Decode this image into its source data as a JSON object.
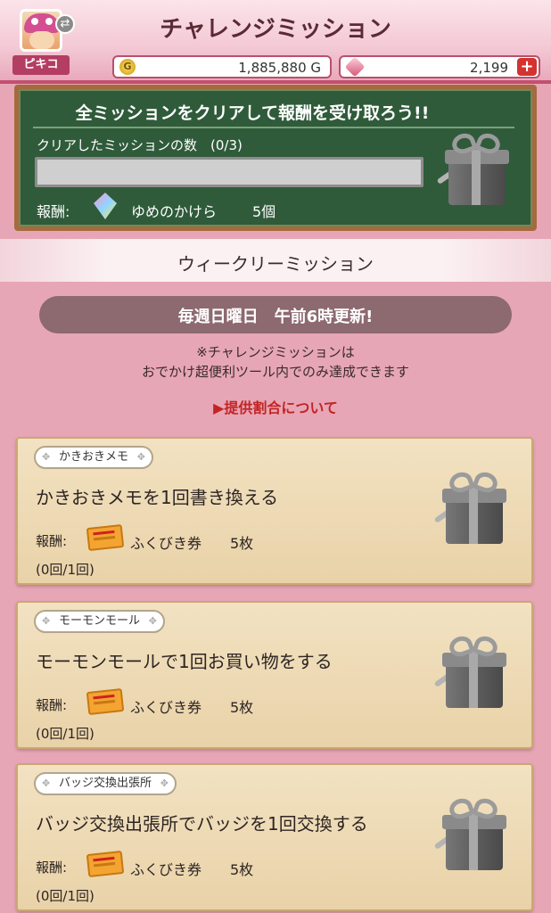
{
  "header": {
    "title": "チャレンジミッション",
    "player_name": "ピキコ",
    "swap_icon": "swap-icon",
    "gold": "1,885,880 G",
    "gold_icon": "G",
    "gems": "2,199",
    "add_symbol": "+"
  },
  "challenge": {
    "headline": "全ミッションをクリアして報酬を受け取ろう!!",
    "count_label": "クリアしたミッションの数　(0/3)",
    "progress_fraction": 0,
    "reward_label": "報酬:",
    "reward_name": "ゆめのかけら",
    "reward_qty": "5個"
  },
  "section": {
    "title": "ウィークリーミッション",
    "schedule": "毎週日曜日　午前6時更新!",
    "note_line1": "※チャレンジミッションは",
    "note_line2": "おでかけ超便利ツール内でのみ達成できます",
    "rate_link": "▶提供割合について"
  },
  "missions": [
    {
      "tag": "かきおきメモ",
      "title": "かきおきメモを1回書き換える",
      "reward_label": "報酬:",
      "reward_name": "ふくびき券",
      "reward_qty": "5枚",
      "progress": "(0回/1回)"
    },
    {
      "tag": "モーモンモール",
      "title": "モーモンモールで1回お買い物をする",
      "reward_label": "報酬:",
      "reward_name": "ふくびき券",
      "reward_qty": "5枚",
      "progress": "(0回/1回)"
    },
    {
      "tag": "バッジ交換出張所",
      "title": "バッジ交換出張所でバッジを1回交換する",
      "reward_label": "報酬:",
      "reward_name": "ふくびき券",
      "reward_qty": "5枚",
      "progress": "(0回/1回)"
    }
  ],
  "colors": {
    "accent": "#c2506f",
    "board": "#2f5b3a",
    "link": "#c22424",
    "background": "#e7a6b6"
  }
}
